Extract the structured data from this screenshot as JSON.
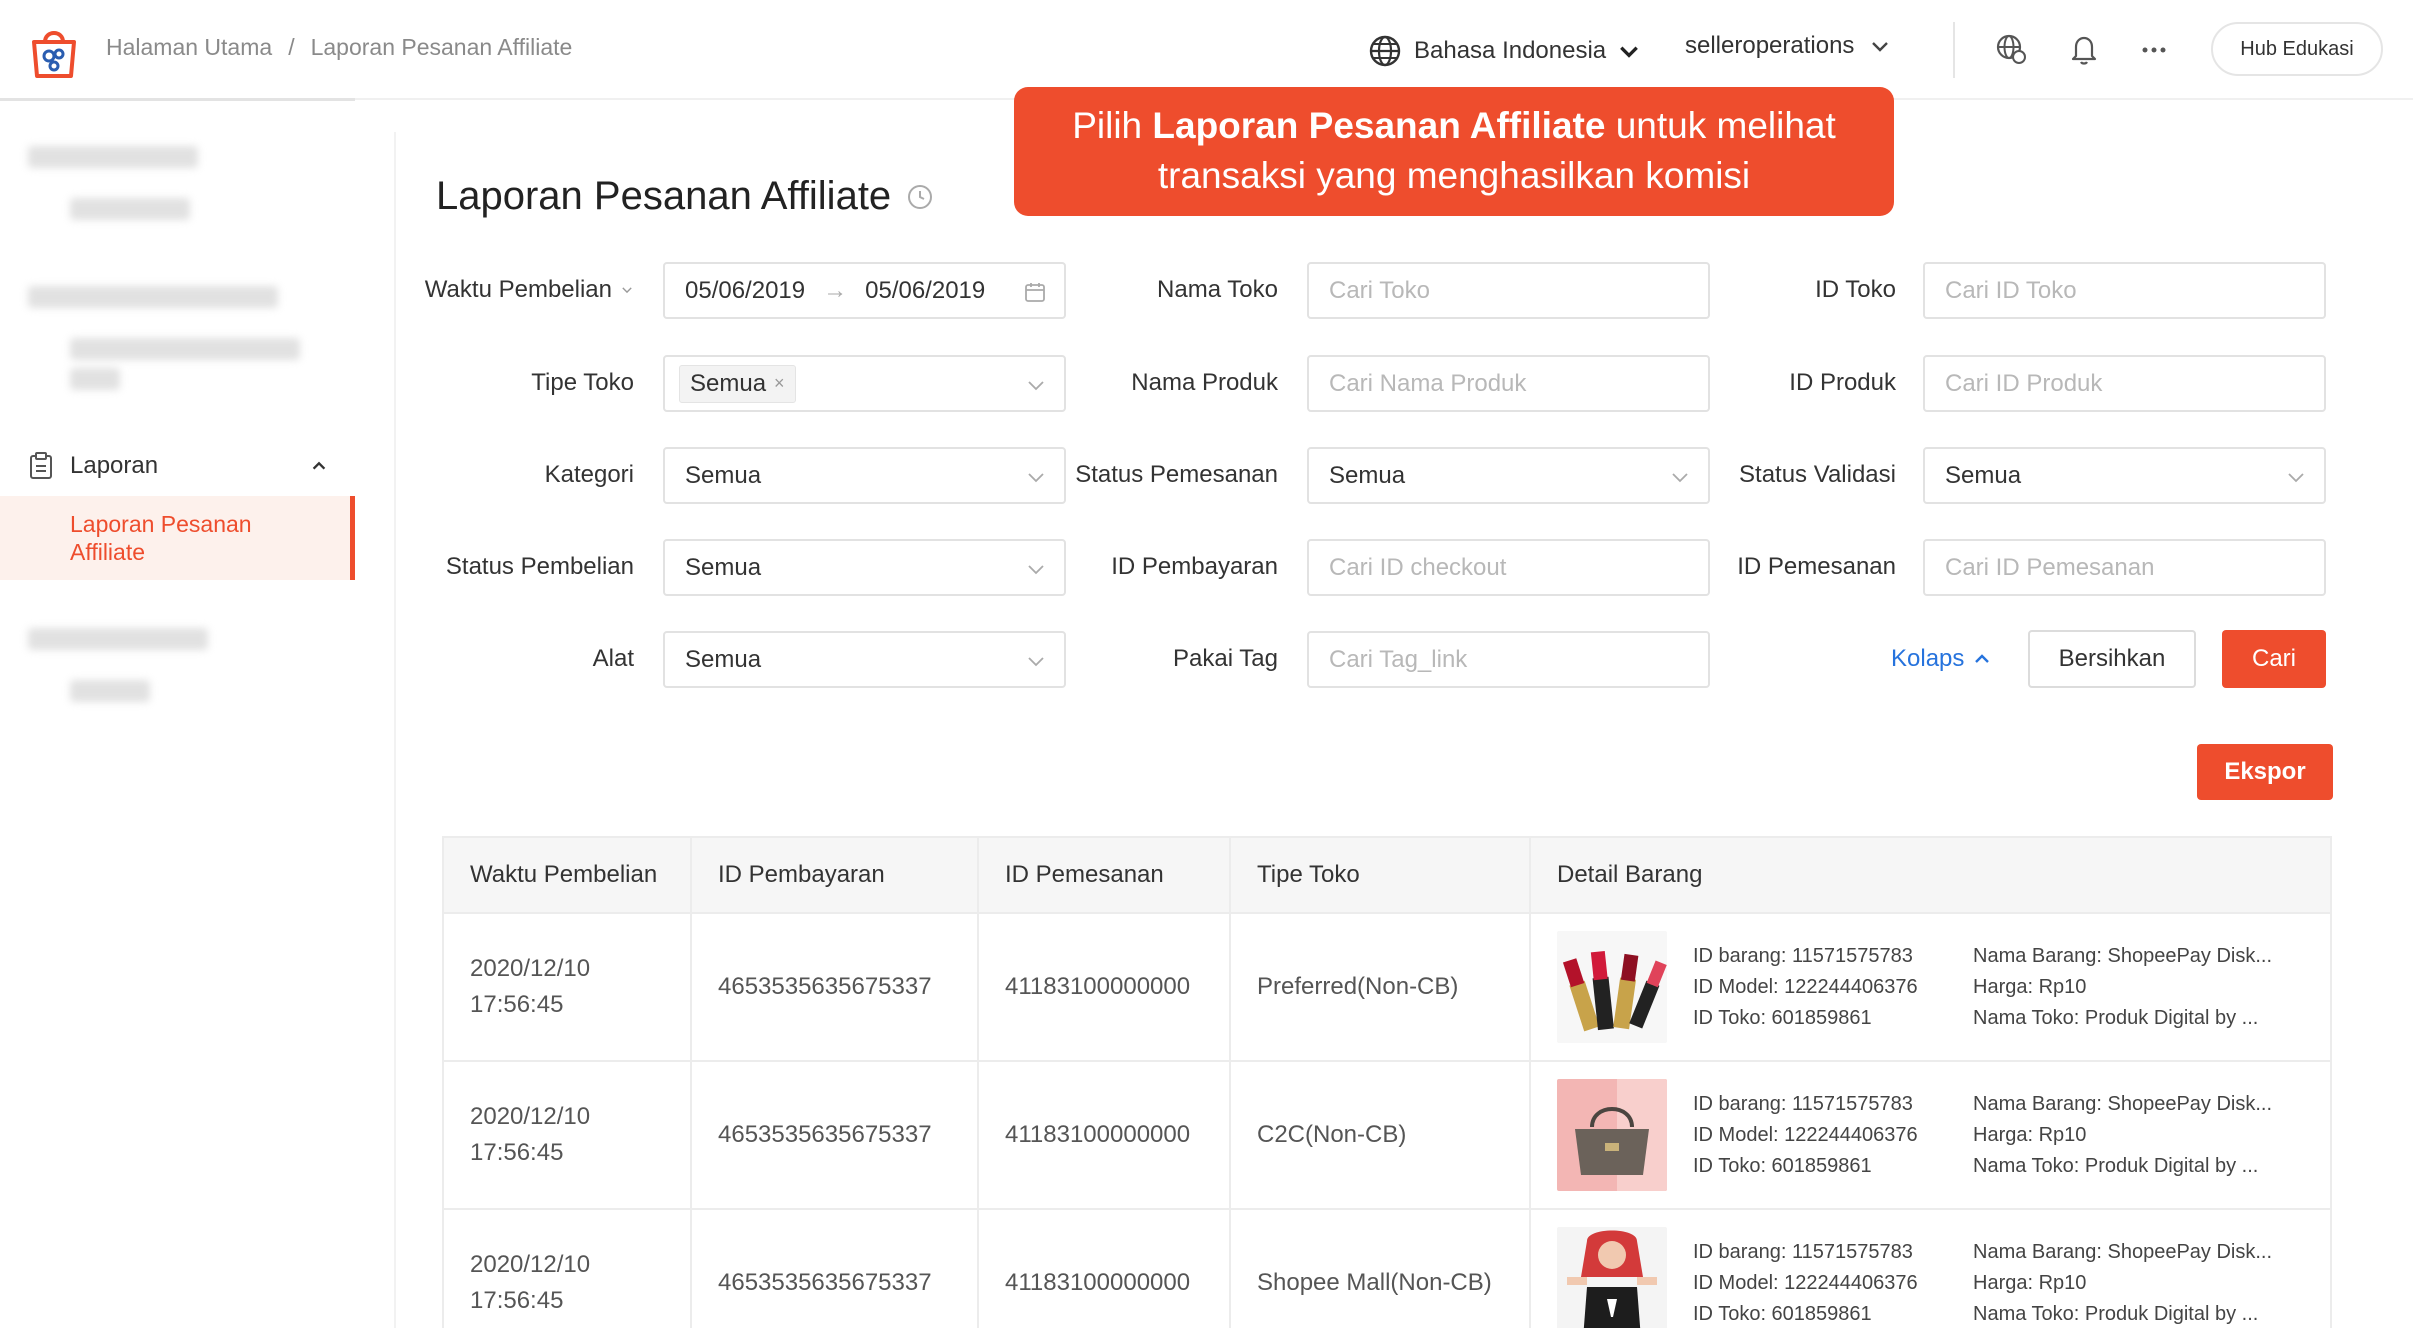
{
  "breadcrumb": {
    "home": "Halaman Utama",
    "sep": "/",
    "current": "Laporan Pesanan Affiliate"
  },
  "header": {
    "language": "Bahasa Indonesia",
    "user": "selleroperations",
    "hub_button": "Hub Edukasi"
  },
  "sidebar": {
    "section_label": "Laporan",
    "active_item": "Laporan Pesanan Affiliate"
  },
  "page": {
    "title": "Laporan Pesanan Affiliate"
  },
  "tooltip": {
    "prefix": "Pilih ",
    "bold": "Laporan Pesanan Affiliate",
    "suffix": " untuk melihat",
    "line2": "transaksi yang menghasilkan komisi"
  },
  "form": {
    "waktu_pembelian": {
      "label": "Waktu Pembelian",
      "start": "05/06/2019",
      "arrow": "→",
      "end": "05/06/2019"
    },
    "nama_toko": {
      "label": "Nama Toko",
      "placeholder": "Cari Toko"
    },
    "id_toko": {
      "label": "ID Toko",
      "placeholder": "Cari ID Toko"
    },
    "tipe_toko": {
      "label": "Tipe Toko",
      "value": "Semua",
      "remove": "×"
    },
    "nama_produk": {
      "label": "Nama Produk",
      "placeholder": "Cari Nama Produk"
    },
    "id_produk": {
      "label": "ID Produk",
      "placeholder": "Cari ID Produk"
    },
    "kategori": {
      "label": "Kategori",
      "value": "Semua"
    },
    "status_pemesanan": {
      "label": "Status Pemesanan",
      "value": "Semua"
    },
    "status_validasi": {
      "label": "Status Validasi",
      "value": "Semua"
    },
    "status_pembelian": {
      "label": "Status Pembelian",
      "value": "Semua"
    },
    "id_pembayaran": {
      "label": "ID Pembayaran",
      "placeholder": "Cari ID checkout"
    },
    "id_pemesanan": {
      "label": "ID Pemesanan",
      "placeholder": "Cari ID Pemesanan"
    },
    "alat": {
      "label": "Alat",
      "value": "Semua"
    },
    "pakai_tag": {
      "label": "Pakai Tag",
      "placeholder": "Cari Tag_link"
    },
    "kolaps": "Kolaps",
    "bersihkan": "Bersihkan",
    "cari": "Cari",
    "ekspor": "Ekspor"
  },
  "table": {
    "headers": [
      "Waktu Pembelian",
      "ID Pembayaran",
      "ID Pemesanan",
      "Tipe Toko",
      "Detail Barang"
    ],
    "rows": [
      {
        "date": "2020/12/10",
        "time": "17:56:45",
        "payment_id": "4653535635675337",
        "order_id": "41183100000000",
        "shop_type": "Preferred(Non-CB)",
        "item_id": "ID barang: 11571575783",
        "model_id": "ID Model: 122244406376",
        "shop_id": "ID Toko: 601859861",
        "item_name": "Nama Barang: ShopeePay Disk...",
        "price": "Harga: Rp10",
        "shop_name": "Nama Toko: Produk Digital by ..."
      },
      {
        "date": "2020/12/10",
        "time": "17:56:45",
        "payment_id": "4653535635675337",
        "order_id": "41183100000000",
        "shop_type": "C2C(Non-CB)",
        "item_id": "ID barang: 11571575783",
        "model_id": "ID Model: 122244406376",
        "shop_id": "ID Toko: 601859861",
        "item_name": "Nama Barang: ShopeePay Disk...",
        "price": "Harga: Rp10",
        "shop_name": "Nama Toko: Produk Digital by ..."
      },
      {
        "date": "2020/12/10",
        "time": "17:56:45",
        "payment_id": "4653535635675337",
        "order_id": "41183100000000",
        "shop_type": "Shopee Mall(Non-CB)",
        "item_id": "ID barang: 11571575783",
        "model_id": "ID Model: 122244406376",
        "shop_id": "ID Toko: 601859861",
        "item_name": "Nama Barang: ShopeePay Disk...",
        "price": "Harga: Rp10",
        "shop_name": "Nama Toko: Produk Digital by ..."
      }
    ]
  },
  "colors": {
    "accent": "#ee4d2d",
    "link": "#2673dd",
    "active_bg": "#fdf1ec"
  },
  "icons": [
    "shopee-bag-icon",
    "globe-icon",
    "chevron-down-icon",
    "language-icon",
    "bell-icon",
    "more-icon",
    "clock-icon",
    "calendar-icon",
    "report-icon",
    "chevron-up-icon",
    "close-icon"
  ]
}
